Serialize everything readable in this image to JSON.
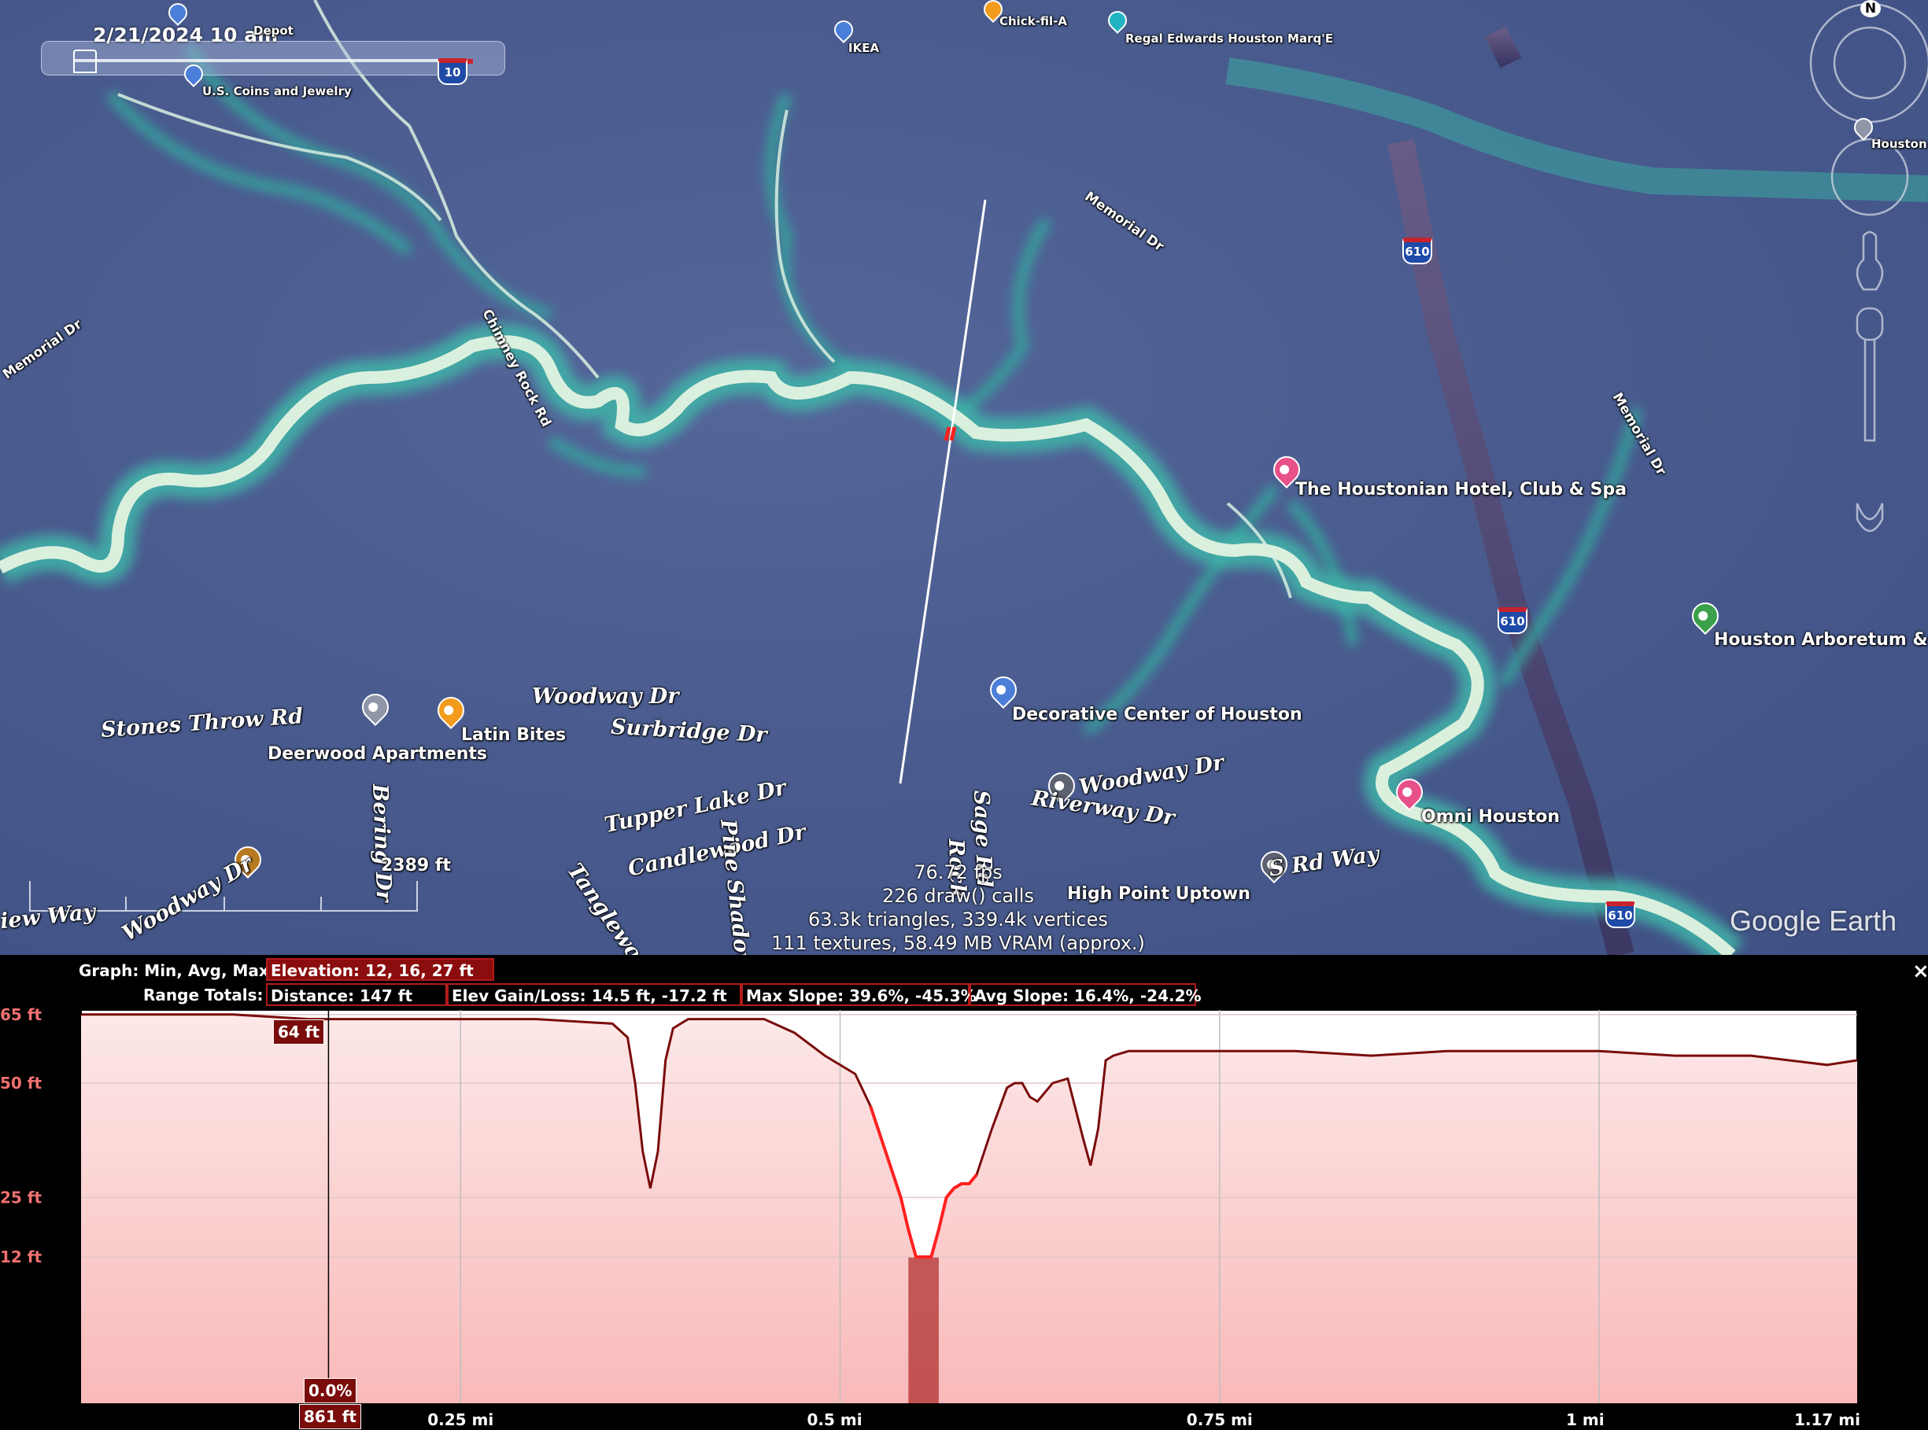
{
  "time_slider": {
    "date_time": "2/21/2024  10 am"
  },
  "map": {
    "roads": {
      "stones_throw": "Stones Throw Rd",
      "woodway_1": "Woodway Dr",
      "surbridge": "Surbridge Dr",
      "tupper_lake": "Tupper Lake Dr",
      "candlewood": "Candlewood Dr",
      "pine_shadows": "Pine Shadows Dr",
      "tanglewood": "Tanglewood",
      "bering": "Bering Dr",
      "woodway_2": "Woodway Dr",
      "woodway_3": "Woodway Dr",
      "riverway": "Riverway Dr",
      "sage": "Sage Rd",
      "rock": "Rock",
      "s_rd_way": "S Rd Way",
      "view_way": "iew Way",
      "chimney_rock": "Chimney Rock Rd",
      "memorial_1": "Memorial Dr",
      "memorial_2": "Memorial Dr",
      "memorial_3": "Memorial Dr"
    },
    "pois": {
      "depot": "Depot",
      "us_coins": "U.S. Coins and Jewelry",
      "ikea": "IKEA",
      "chick_fil_a": "Chick-fil-A",
      "regal": "Regal Edwards Houston Marq'E",
      "houston_right": "Houston",
      "houstonian": "The Houstonian Hotel, Club & Spa",
      "arboretum": "Houston Arboretum & N",
      "decorative_center": "Decorative Center of Houston",
      "omni": "Omni Houston",
      "high_point": "High Point Uptown",
      "deerwood": "Deerwood Apartments",
      "latin_bites": "Latin Bites"
    },
    "shields": {
      "i10": "10",
      "i610_a": "610",
      "i610_b": "610",
      "i610_c": "610"
    },
    "scale_label": "2389 ft",
    "compass_north": "N",
    "stats": {
      "fps": "76.72 fps",
      "draw_calls": "226 draw() calls",
      "triangles": "63.3k triangles, 339.4k vertices",
      "textures": "111 textures, 58.49 MB VRAM (approx.)"
    },
    "logo": "Google Earth",
    "colors": {
      "terrain": "#4a5c8f",
      "river": "#dff2e4",
      "river_glow": "#3fb3a8",
      "path_line": "#ffffff"
    }
  },
  "profile": {
    "graph_label": "Graph: Min, Avg, Max",
    "elevation": "Elevation: 12, 16, 27 ft",
    "range_label": "Range Totals:",
    "distance": "Distance: 147 ft",
    "elev_gain_loss": "Elev Gain/Loss: 14.5 ft, -17.2 ft",
    "max_slope": "Max Slope: 39.6%, -45.3%",
    "avg_slope": "Avg Slope: 16.4%, -24.2%",
    "cursor_elevation": "64 ft",
    "cursor_slope": "0.0%",
    "cursor_distance": "861 ft",
    "close": "×",
    "colors": {
      "line": "#7a0c0c",
      "highlight": "#ff2020",
      "fill": "#f9b9b9",
      "selection": "#b03030"
    }
  },
  "chart_data": {
    "type": "area",
    "xlabel": "",
    "ylabel": "",
    "x_ticks": [
      "0.25 mi",
      "0.5 mi",
      "0.75 mi",
      "1 mi",
      "1.17 mi"
    ],
    "y_ticks": [
      "65 ft",
      "50 ft",
      "25 ft",
      "12 ft"
    ],
    "y_tick_values": [
      65,
      50,
      25,
      12
    ],
    "x_tick_values": [
      0.25,
      0.5,
      0.75,
      1.0,
      1.17
    ],
    "xlim": [
      0,
      1.17
    ],
    "ylim": [
      -20,
      66
    ],
    "grid": true,
    "series": [
      {
        "x": [
          0.0,
          0.05,
          0.1,
          0.15,
          0.2,
          0.25,
          0.3,
          0.35,
          0.36,
          0.365,
          0.37,
          0.375,
          0.38,
          0.385,
          0.39,
          0.395,
          0.4,
          0.45,
          0.47,
          0.49,
          0.51,
          0.52,
          0.53,
          0.54,
          0.545,
          0.55,
          0.555,
          0.56,
          0.565,
          0.57,
          0.575,
          0.58,
          0.585,
          0.59,
          0.6,
          0.61,
          0.615,
          0.62,
          0.625,
          0.63,
          0.64,
          0.65,
          0.66,
          0.665,
          0.67,
          0.675,
          0.68,
          0.69,
          0.7,
          0.75,
          0.8,
          0.85,
          0.9,
          0.95,
          1.0,
          1.05,
          1.1,
          1.15,
          1.17
        ],
        "y": [
          65,
          65,
          65,
          64,
          64,
          64,
          64,
          63,
          60,
          50,
          35,
          27,
          35,
          55,
          62,
          63,
          64,
          64,
          61,
          56,
          52,
          45,
          35,
          25,
          18,
          12,
          12,
          12,
          18,
          25,
          27,
          28,
          28,
          30,
          40,
          49,
          50,
          50,
          47,
          46,
          50,
          51,
          38,
          32,
          40,
          55,
          56,
          57,
          57,
          57,
          57,
          56,
          57,
          57,
          57,
          56,
          56,
          54,
          55
        ]
      }
    ],
    "highlight_range": [
      0.545,
      0.565
    ],
    "cursor_x": 0.163
  }
}
